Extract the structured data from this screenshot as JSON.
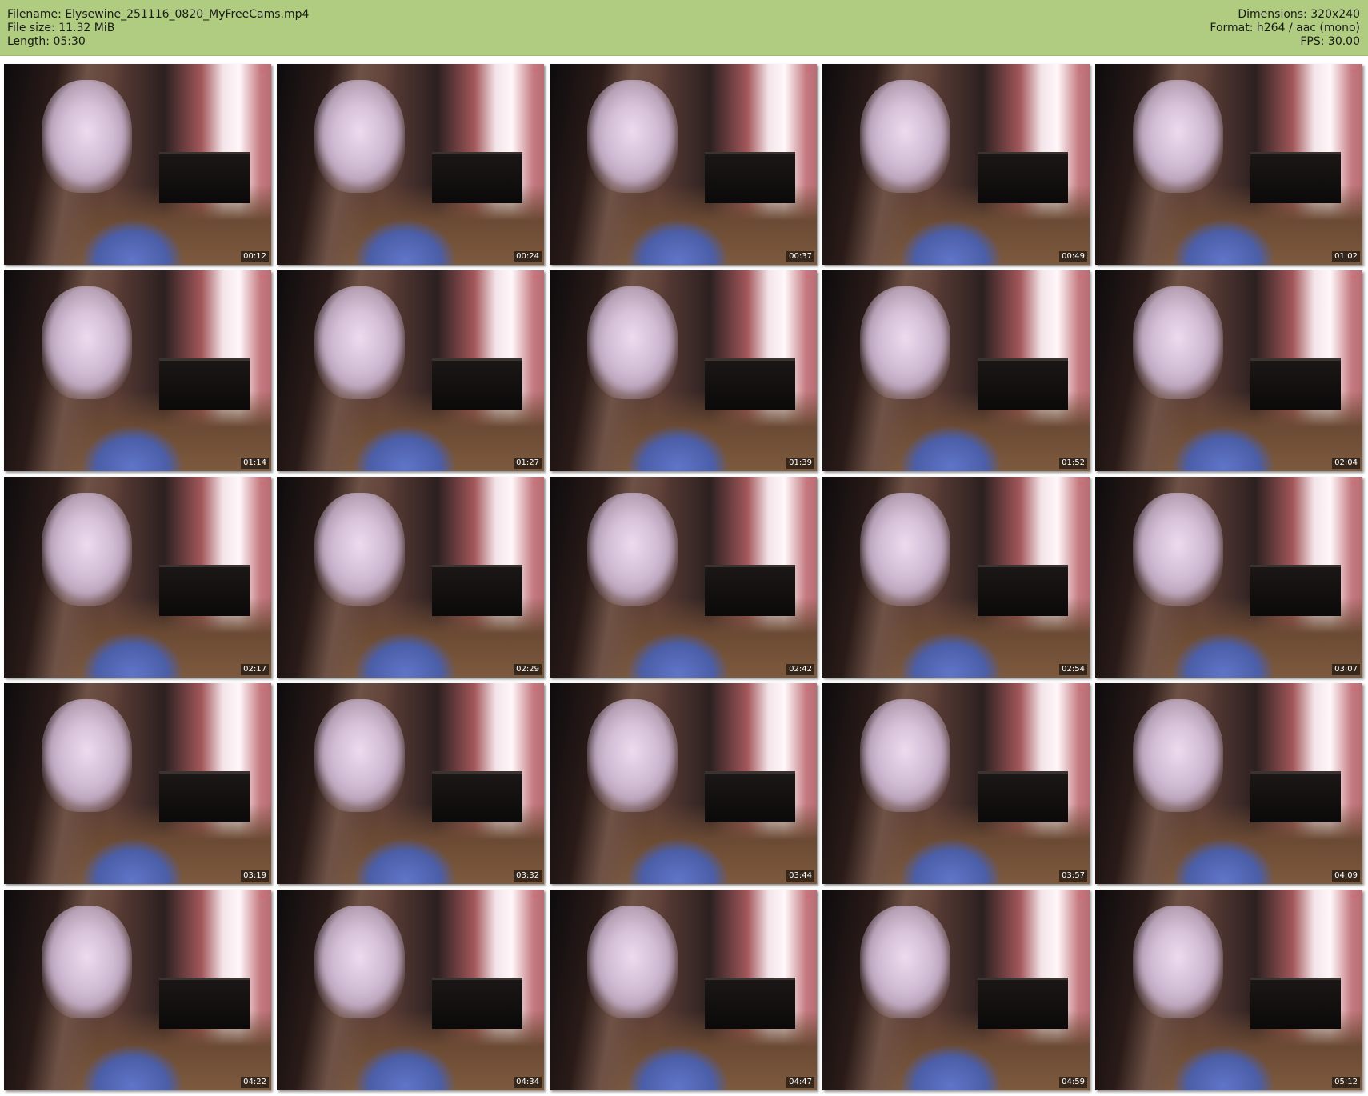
{
  "header": {
    "filename_label": "Filename:",
    "filename": "Elysewine_251116_0820_MyFreeCams.mp4",
    "filesize_label": "File size:",
    "filesize": "11.32 MiB",
    "length_label": "Length:",
    "length": "05:30",
    "dimensions_label": "Dimensions:",
    "dimensions": "320x240",
    "format_label": "Format:",
    "format": "h264 / aac (mono)",
    "fps_label": "FPS:",
    "fps": "30.00"
  },
  "colors": {
    "header_bg": "#b0cc80",
    "timestamp_bg": "rgba(0,0,0,0.55)"
  },
  "thumbnails": [
    {
      "timestamp": "00:12"
    },
    {
      "timestamp": "00:24"
    },
    {
      "timestamp": "00:37"
    },
    {
      "timestamp": "00:49"
    },
    {
      "timestamp": "01:02"
    },
    {
      "timestamp": "01:14"
    },
    {
      "timestamp": "01:27"
    },
    {
      "timestamp": "01:39"
    },
    {
      "timestamp": "01:52"
    },
    {
      "timestamp": "02:04"
    },
    {
      "timestamp": "02:17"
    },
    {
      "timestamp": "02:29"
    },
    {
      "timestamp": "02:42"
    },
    {
      "timestamp": "02:54"
    },
    {
      "timestamp": "03:07"
    },
    {
      "timestamp": "03:19"
    },
    {
      "timestamp": "03:32"
    },
    {
      "timestamp": "03:44"
    },
    {
      "timestamp": "03:57"
    },
    {
      "timestamp": "04:09"
    },
    {
      "timestamp": "04:22"
    },
    {
      "timestamp": "04:34"
    },
    {
      "timestamp": "04:47"
    },
    {
      "timestamp": "04:59"
    },
    {
      "timestamp": "05:12"
    }
  ]
}
